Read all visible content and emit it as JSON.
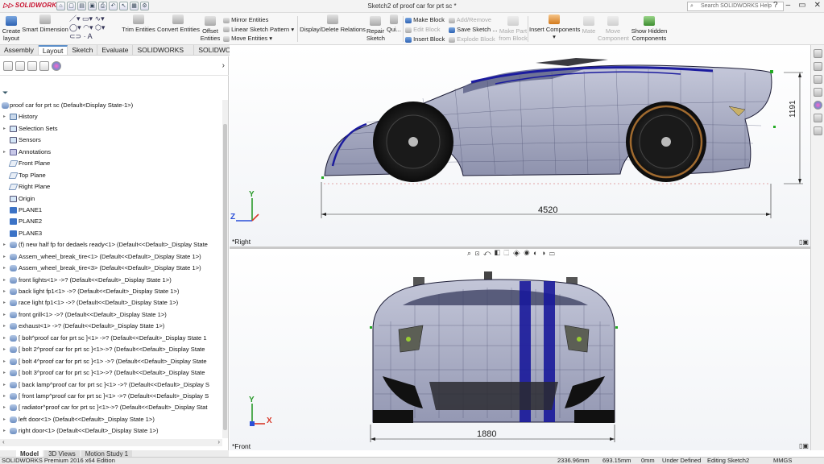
{
  "app": {
    "logo_text": "SOLIDWORKS",
    "document_title": "Sketch2 of proof car for prt sc *",
    "search_placeholder": "Search SOLIDWORKS Help",
    "accent_color": "#5b8ec8",
    "brand_color": "#c8102e"
  },
  "ribbon": {
    "create_layout": [
      "Create",
      "layout"
    ],
    "smart_dimension": "Smart Dimension",
    "trim_entities": "Trim Entities",
    "convert_entities": "Convert Entities",
    "offset_entities": [
      "Offset",
      "Entities"
    ],
    "mirror_entities": "Mirror Entities",
    "linear_sketch_pattern": "Linear Sketch Pattern",
    "move_entities": "Move Entities",
    "display_delete_relations": "Display/Delete Relations",
    "repair_sketch": [
      "Repair",
      "Sketch"
    ],
    "quick_snaps": "Qui...",
    "make_block": "Make Block",
    "edit_block": "Edit Block",
    "insert_block": "Insert Block",
    "add_remove": "Add/Remove",
    "save_sketch": "Save Sketch ...",
    "explode_block": "Explode Block",
    "make_part_from_block": [
      "Make Part",
      "from Block"
    ],
    "insert_components": "Insert Components",
    "mate": "Mate",
    "move_component": [
      "Move",
      "Component"
    ],
    "show_hidden_components": [
      "Show Hidden",
      "Components"
    ]
  },
  "command_tabs": [
    {
      "label": "Assembly",
      "active": false
    },
    {
      "label": "Layout",
      "active": true
    },
    {
      "label": "Sketch",
      "active": false
    },
    {
      "label": "Evaluate",
      "active": false
    },
    {
      "label": "SOLIDWORKS Add-Ins",
      "active": false
    },
    {
      "label": "SOLIDWORKS MBD",
      "active": false
    }
  ],
  "tree": {
    "root": "proof car for prt sc  (Default<Display State-1>)",
    "items": [
      {
        "label": "History",
        "icon": "folder-icon",
        "expandable": true
      },
      {
        "label": "Selection Sets",
        "icon": "selection-sets-icon",
        "expandable": true
      },
      {
        "label": "Sensors",
        "icon": "sensors-icon",
        "expandable": false
      },
      {
        "label": "Annotations",
        "icon": "annotations-icon",
        "expandable": true
      },
      {
        "label": "Front Plane",
        "icon": "plane-icon",
        "expandable": false
      },
      {
        "label": "Top Plane",
        "icon": "plane-icon",
        "expandable": false
      },
      {
        "label": "Right Plane",
        "icon": "plane-icon",
        "expandable": false
      },
      {
        "label": "Origin",
        "icon": "origin-icon",
        "expandable": false
      },
      {
        "label": "PLANE1",
        "icon": "sketch-plane-icon",
        "expandable": false
      },
      {
        "label": "PLANE2",
        "icon": "sketch-plane-icon",
        "expandable": false
      },
      {
        "label": "PLANE3",
        "icon": "sketch-plane-icon",
        "expandable": false
      },
      {
        "label": "(f) new half fp for dedaels ready<1> (Default<<Default>_Display State",
        "icon": "component-icon",
        "expandable": true
      },
      {
        "label": "Assem_wheel_break_tire<1> (Default<<Default>_Display State 1>)",
        "icon": "component-icon",
        "expandable": true
      },
      {
        "label": "Assem_wheel_break_tire<3> (Default<<Default>_Display State 1>)",
        "icon": "component-icon",
        "expandable": true
      },
      {
        "label": "front lights<1> ->? (Default<<Default>_Display State 1>)",
        "icon": "component-icon",
        "expandable": true
      },
      {
        "label": "back light fp1<1> ->? (Default<<Default>_Display State 1>)",
        "icon": "component-icon",
        "expandable": true
      },
      {
        "label": "race light fp1<1> ->? (Default<<Default>_Display State 1>)",
        "icon": "component-icon",
        "expandable": true
      },
      {
        "label": "front grill<1> ->? (Default<<Default>_Display State 1>)",
        "icon": "component-icon",
        "expandable": true
      },
      {
        "label": "exhaust<1> ->? (Default<<Default>_Display State 1>)",
        "icon": "component-icon",
        "expandable": true
      },
      {
        "label": "[ bolt^proof car for prt sc ]<1> ->? (Default<<Default>_Display State 1",
        "icon": "component-icon",
        "expandable": true
      },
      {
        "label": "[ bolt 2^proof car for prt sc ]<1>->? (Default<<Default>_Display State",
        "icon": "component-icon",
        "expandable": true
      },
      {
        "label": "[ bolt 4^proof car for prt sc ]<1> ->? (Default<<Default>_Display State",
        "icon": "component-icon",
        "expandable": true
      },
      {
        "label": "[ bolt 3^proof car for prt sc ]<1>->? (Default<<Default>_Display State",
        "icon": "component-icon",
        "expandable": true
      },
      {
        "label": "[ back lamp^proof car for prt sc ]<1> ->? (Default<<Default>_Display S",
        "icon": "component-icon",
        "expandable": true
      },
      {
        "label": "[ front lamp^proof car for prt sc ]<1> ->? (Default<<Default>_Display S",
        "icon": "component-icon",
        "expandable": true
      },
      {
        "label": "[ radiator^proof car for prt sc ]<1>->? (Default<<Default>_Display Stat",
        "icon": "component-icon",
        "expandable": true
      },
      {
        "label": "left door<1> (Default<<Default>_Display State 1>)",
        "icon": "component-icon",
        "expandable": true
      },
      {
        "label": "right door<1> (Default<<Default>_Display State 1>)",
        "icon": "component-icon",
        "expandable": true
      }
    ]
  },
  "viewports": {
    "top": {
      "name": "*Right",
      "dim_length": "4520",
      "dim_height": "1191",
      "axis_up": "Y",
      "axis_right": "Z"
    },
    "bottom": {
      "name": "*Front",
      "dim_width": "1880",
      "axis_up": "Y",
      "axis_right": "X"
    }
  },
  "bottom_tabs": [
    {
      "label": "Model",
      "active": true
    },
    {
      "label": "3D Views",
      "active": false
    },
    {
      "label": "Motion Study 1",
      "active": false
    }
  ],
  "status": {
    "edition": "SOLIDWORKS Premium 2016 x64 Edition",
    "x": "2336.96mm",
    "y": "693.15mm",
    "z": "0mm",
    "definition": "Under Defined",
    "editing": "Editing Sketch2",
    "units": "MMGS"
  }
}
